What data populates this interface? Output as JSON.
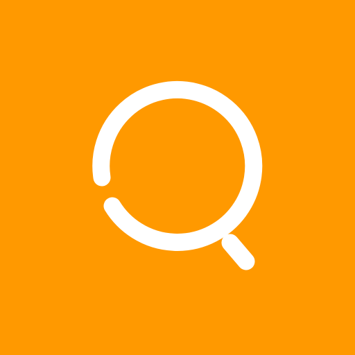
{
  "icon": {
    "name": "search-icon",
    "background_color": "#FF9900",
    "glyph_color": "#FFFFFF"
  }
}
